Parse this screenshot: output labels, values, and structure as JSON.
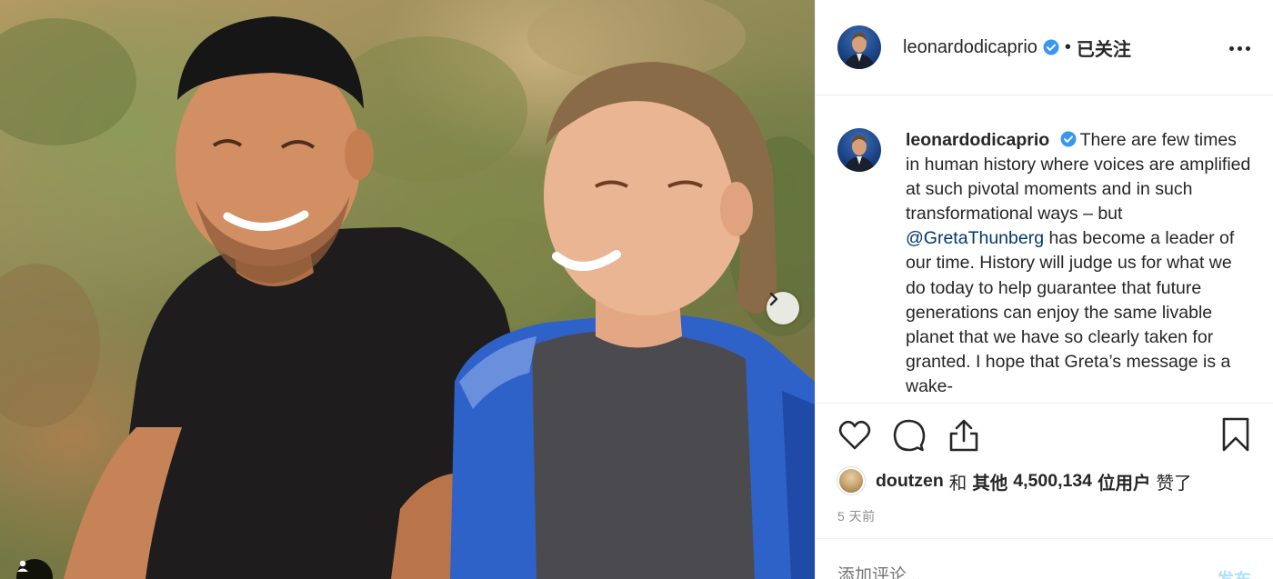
{
  "header": {
    "username": "leonardodicaprio",
    "dot": "•",
    "follow_status": "已关注"
  },
  "caption": {
    "username": "leonardodicaprio",
    "text_part1": "There are few times in human history where voices are amplified at such pivotal moments and in such transformational ways – but ",
    "mention": "@GretaThunberg",
    "text_part2": " has become a leader of our time. History will judge us for what we do today to help guarantee that future generations can enjoy the same livable planet that we have so clearly taken for granted. I hope that Greta’s message is a wake-"
  },
  "likes": {
    "user": "doutzen",
    "and": "和",
    "others": "其他",
    "count": "4,500,134",
    "unit": "位用户",
    "suffix": "赞了"
  },
  "time": "5 天前",
  "comment": {
    "placeholder": "添加评论...",
    "post_label": "发布"
  },
  "icons": {
    "verified": "verified-badge-icon",
    "more": "more-options-icon",
    "like": "heart-icon",
    "comment": "comment-bubble-icon",
    "share": "share-icon",
    "save": "bookmark-icon",
    "next": "chevron-right-icon",
    "tag": "user-tag-icon"
  },
  "colors": {
    "verified_blue": "#3897f0",
    "mention": "#00376b",
    "muted": "#8e8e8e"
  }
}
